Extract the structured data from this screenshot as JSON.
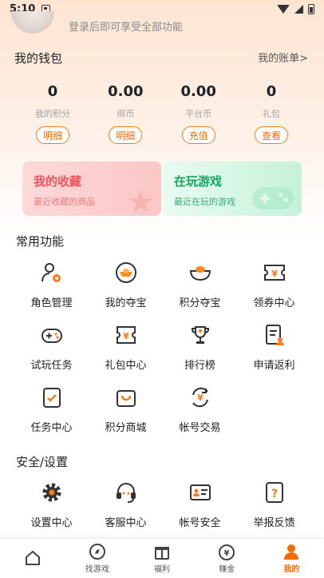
{
  "status_bar": {
    "time": "5:10"
  },
  "header": {
    "login_hint": "登录后即可享受全部功能"
  },
  "wallet": {
    "title": "我的钱包",
    "bill_link": "我的账单>",
    "items": [
      {
        "value": "0",
        "label": "我的积分",
        "button": "明细"
      },
      {
        "value": "0.00",
        "label": "绑币",
        "button": "明细"
      },
      {
        "value": "0.00",
        "label": "平台币",
        "button": "充值"
      },
      {
        "value": "0",
        "label": "礼包",
        "button": "查看"
      }
    ]
  },
  "cards": {
    "favorites": {
      "title": "我的收藏",
      "subtitle": "最近收藏的商品"
    },
    "playing": {
      "title": "在玩游戏",
      "subtitle": "最近在玩的游戏"
    }
  },
  "common": {
    "title": "常用功能",
    "items": [
      {
        "label": "角色管理",
        "icon": "user-gear-icon"
      },
      {
        "label": "我的夺宝",
        "icon": "gold-ingot-circle-icon"
      },
      {
        "label": "积分夺宝",
        "icon": "gold-ingot-icon"
      },
      {
        "label": "领券中心",
        "icon": "coupon-yen-icon"
      },
      {
        "label": "试玩任务",
        "icon": "gamepad-icon"
      },
      {
        "label": "礼包中心",
        "icon": "gift-ticket-icon"
      },
      {
        "label": "排行榜",
        "icon": "trophy-icon"
      },
      {
        "label": "申请返利",
        "icon": "rebate-document-icon"
      },
      {
        "label": "任务中心",
        "icon": "task-check-icon"
      },
      {
        "label": "积分商城",
        "icon": "shopping-bag-icon"
      },
      {
        "label": "帐号交易",
        "icon": "account-trade-icon"
      }
    ]
  },
  "security": {
    "title": "安全/设置",
    "items": [
      {
        "label": "设置中心",
        "icon": "settings-gear-icon"
      },
      {
        "label": "客服中心",
        "icon": "headset-icon"
      },
      {
        "label": "帐号安全",
        "icon": "id-card-icon"
      },
      {
        "label": "举报反馈",
        "icon": "question-report-icon"
      }
    ]
  },
  "tabbar": {
    "items": [
      {
        "label": "",
        "icon": "home-icon"
      },
      {
        "label": "找游戏",
        "icon": "compass-icon"
      },
      {
        "label": "福利",
        "icon": "gift-box-icon"
      },
      {
        "label": "赚金",
        "icon": "money-bag-icon"
      },
      {
        "label": "我的",
        "icon": "profile-icon",
        "active": true
      }
    ]
  },
  "colors": {
    "accent": "#ff6a00",
    "icon_dark": "#333333"
  }
}
